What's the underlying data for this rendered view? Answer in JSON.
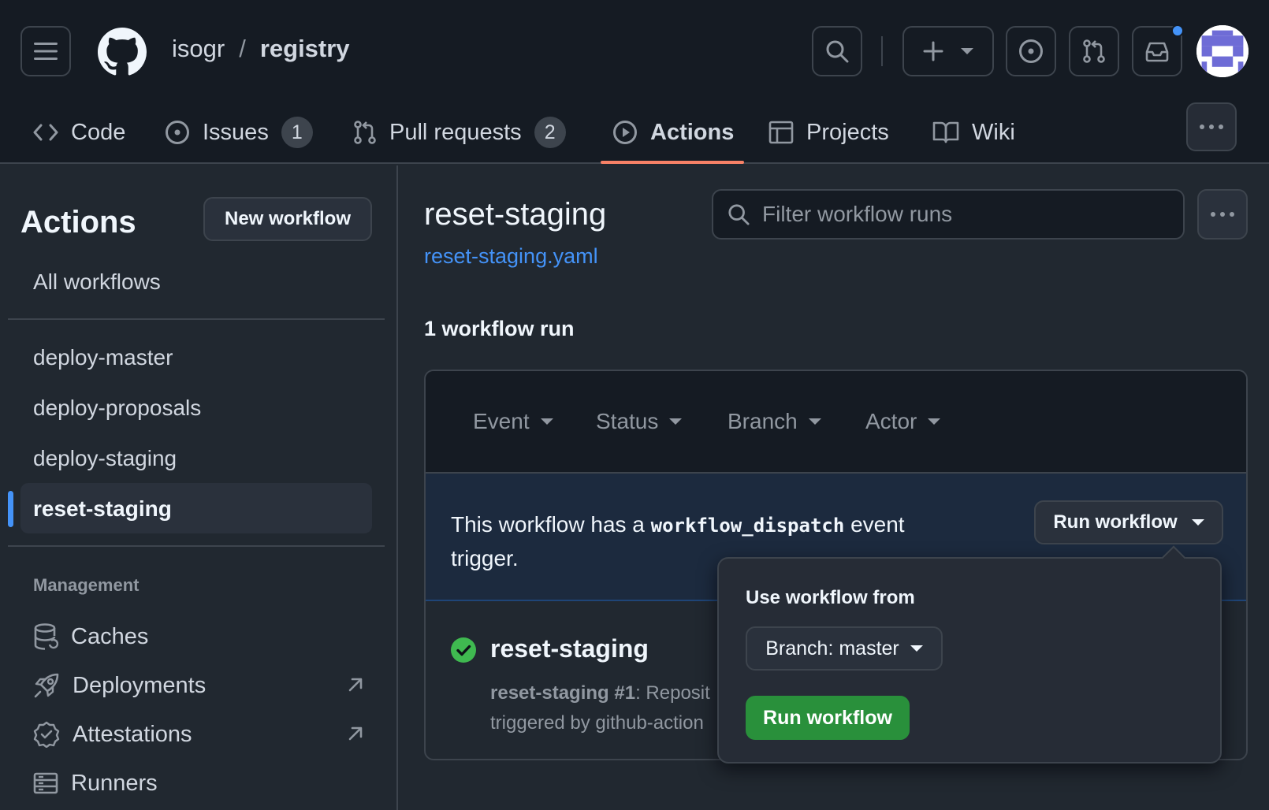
{
  "repo": {
    "owner": "isogr",
    "separator": "/",
    "name": "registry"
  },
  "tabs": [
    {
      "label": "Code",
      "icon": "code-icon"
    },
    {
      "label": "Issues",
      "icon": "issue-opened-icon",
      "count": "1"
    },
    {
      "label": "Pull requests",
      "icon": "git-pull-request-icon",
      "count": "2"
    },
    {
      "label": "Actions",
      "icon": "play-icon",
      "active": true
    },
    {
      "label": "Projects",
      "icon": "table-icon"
    },
    {
      "label": "Wiki",
      "icon": "book-icon"
    }
  ],
  "sidebar": {
    "title": "Actions",
    "new_workflow": "New workflow",
    "all_workflows": "All workflows",
    "workflows": [
      "deploy-master",
      "deploy-proposals",
      "deploy-staging",
      "reset-staging"
    ],
    "active_workflow": "reset-staging",
    "management_heading": "Management",
    "management": [
      {
        "label": "Caches",
        "icon": "database-icon"
      },
      {
        "label": "Deployments",
        "icon": "rocket-icon",
        "external": true
      },
      {
        "label": "Attestations",
        "icon": "verified-icon",
        "external": true
      },
      {
        "label": "Runners",
        "icon": "server-icon"
      }
    ]
  },
  "main": {
    "title": "reset-staging",
    "file": "reset-staging.yaml",
    "filter_placeholder": "Filter workflow runs",
    "run_count": "1 workflow run",
    "filters": [
      "Event",
      "Status",
      "Branch",
      "Actor"
    ],
    "dispatch": {
      "prefix": "This workflow has a",
      "code": "workflow_dispatch",
      "suffix": "event trigger."
    },
    "run_workflow_toggle": "Run workflow",
    "run": {
      "status": "success",
      "title": "reset-staging",
      "name": "reset-staging",
      "number": "#1",
      "desc": ": Reposit",
      "trigger": "triggered by github-action"
    }
  },
  "popover": {
    "label": "Use workflow from",
    "branch_button": "Branch: master",
    "run_button": "Run workflow"
  },
  "colors": {
    "accent_blue": "#4493f8",
    "active_tab_underline": "#f78166",
    "success_green": "#29903b"
  }
}
